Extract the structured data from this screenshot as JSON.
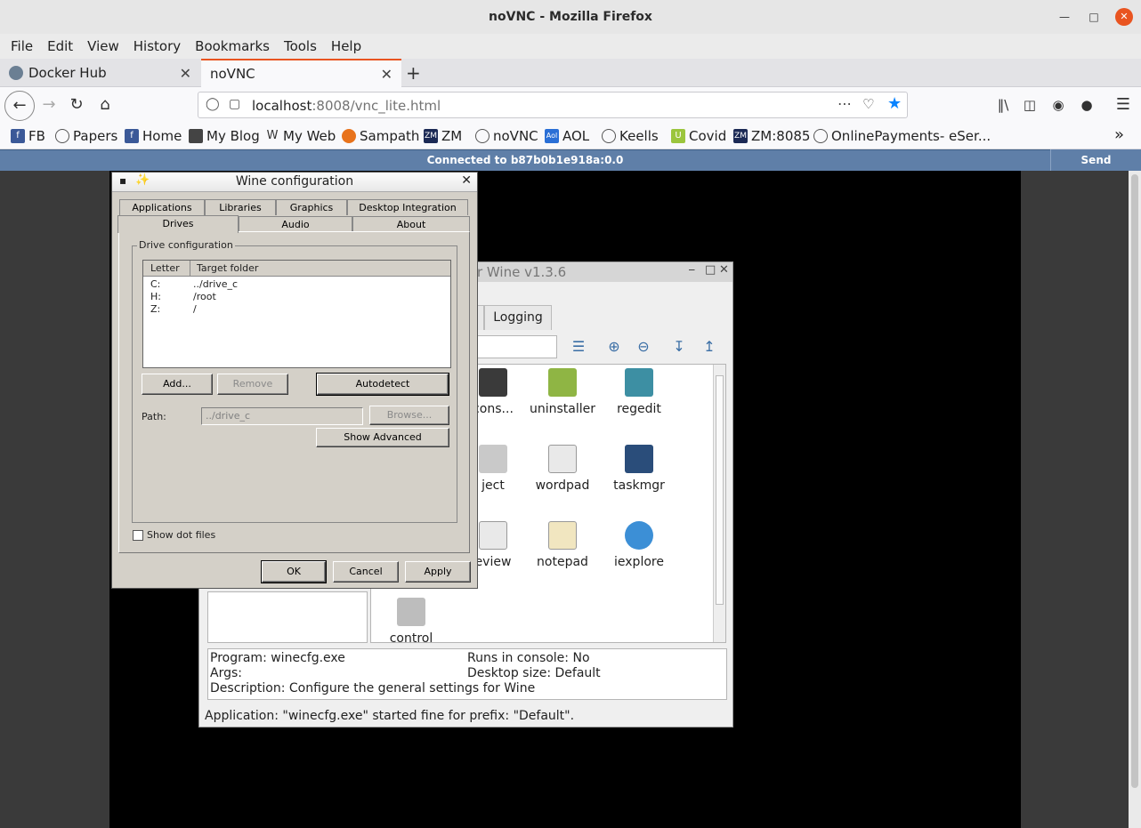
{
  "browser": {
    "window_title": "noVNC - Mozilla Firefox",
    "menu": [
      "File",
      "Edit",
      "View",
      "History",
      "Bookmarks",
      "Tools",
      "Help"
    ],
    "tabs": [
      {
        "label": "Docker Hub"
      },
      {
        "label": "noVNC"
      }
    ],
    "url_host": "localhost",
    "url_rest": ":8008/vnc_lite.html",
    "bookmarks": [
      "FB",
      "Papers",
      "Home",
      "My Blog",
      "My Web",
      "Sampath",
      "ZM",
      "noVNC",
      "AOL",
      "Keells",
      "Covid",
      "ZM:8085",
      "OnlinePayments- eSer..."
    ],
    "accent_color": "#e95420"
  },
  "novnc": {
    "status": "Connected to b87b0b1e918a:0.0",
    "send_cad": "Send CtrlAltDel"
  },
  "bgwin": {
    "title": "r Wine v1.3.6",
    "logging_tab": "Logging",
    "programs": [
      "cons...",
      "uninstaller",
      "regedit",
      "ject",
      "wordpad",
      "taskmgr",
      "eview",
      "notepad",
      "iexplore",
      "control"
    ],
    "info": {
      "program": "Program: winecfg.exe",
      "console": "Runs in console: No",
      "args": "Args:",
      "desktop": "Desktop size: Default",
      "description": "Description: Configure the general settings for Wine"
    },
    "status": "Application: \"winecfg.exe\" started fine for prefix: \"Default\"."
  },
  "winecfg": {
    "title": "Wine configuration",
    "tabs_row1": [
      "Applications",
      "Libraries",
      "Graphics",
      "Desktop Integration"
    ],
    "tabs_row2": [
      "Drives",
      "Audio",
      "About"
    ],
    "group_label": "Drive configuration",
    "columns": {
      "letter": "Letter",
      "target": "Target folder"
    },
    "drives": [
      {
        "letter": "C:",
        "target": "../drive_c"
      },
      {
        "letter": "H:",
        "target": "/root"
      },
      {
        "letter": "Z:",
        "target": "/"
      }
    ],
    "buttons": {
      "add": "Add...",
      "remove": "Remove",
      "autodetect": "Autodetect",
      "browse": "Browse...",
      "show_advanced": "Show Advanced",
      "ok": "OK",
      "cancel": "Cancel",
      "apply": "Apply"
    },
    "path_label": "Path:",
    "path_value": "../drive_c",
    "show_dot_files": "Show dot files"
  }
}
